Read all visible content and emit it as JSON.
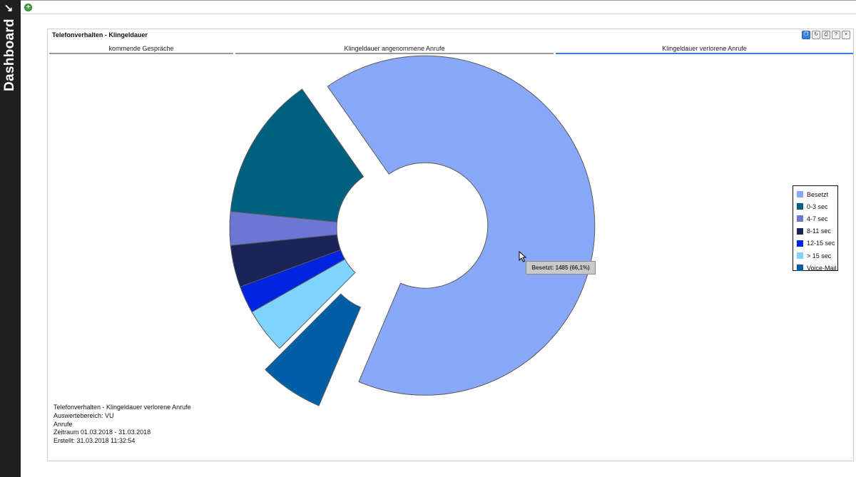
{
  "sidebar": {
    "label": "Dashboard",
    "toggle_icon": "expand-arrow-icon"
  },
  "toolbar": {
    "add_icon": "add-icon"
  },
  "panel": {
    "title": "Telefonverhalten - Klingeldauer",
    "tools": [
      "copy-icon",
      "refresh-icon",
      "print-icon",
      "help-icon",
      "close-icon"
    ]
  },
  "tabs": [
    {
      "label": "kommende Gespräche"
    },
    {
      "label": "Klingeldauer angenommene Anrufe"
    },
    {
      "label": "Klingeldauer verlorene Anrufe",
      "active": true
    }
  ],
  "chart_data": {
    "type": "pie",
    "donut": true,
    "legend_position": "right",
    "slices": [
      {
        "label": "Besetzt",
        "value": 66.1,
        "color": "#8aa8f8",
        "exploded": true
      },
      {
        "label": "Voice-Mail",
        "value": 6.1,
        "color": "#005fa6",
        "exploded": true
      },
      {
        "label": "> 15 sec",
        "value": 4.3,
        "color": "#7fd4ff",
        "exploded": false
      },
      {
        "label": "12-15 sec",
        "value": 2.6,
        "color": "#0024e0",
        "exploded": false
      },
      {
        "label": "8-11 sec",
        "value": 4.0,
        "color": "#1b2459",
        "exploded": false
      },
      {
        "label": "4-7 sec",
        "value": 3.2,
        "color": "#6c76d4",
        "exploded": false
      },
      {
        "label": "0-3 sec",
        "value": 13.7,
        "color": "#006080",
        "exploded": false
      }
    ],
    "legend": [
      {
        "label": "Besetzt",
        "color": "#8aa8f8"
      },
      {
        "label": "0-3 sec",
        "color": "#006080"
      },
      {
        "label": "4-7 sec",
        "color": "#6c76d4"
      },
      {
        "label": "8-11 sec",
        "color": "#1b2459"
      },
      {
        "label": "12-15 sec",
        "color": "#0024e0"
      },
      {
        "label": "> 15 sec",
        "color": "#7fd4ff"
      },
      {
        "label": "Voice-Mail",
        "color": "#005fa6"
      }
    ],
    "tooltip": "Besetzt: 1485 (66,1%)"
  },
  "info": {
    "line1": "Telefonverhalten - Klingeldauer verlorene Anrufe",
    "line2": "Auswertebereich: VU",
    "line3": "Anrufe",
    "line4": "Zeitraum 01.03.2018 - 31.03.2018",
    "line5": "Erstellt: 31.03.2018 11:32:54"
  }
}
